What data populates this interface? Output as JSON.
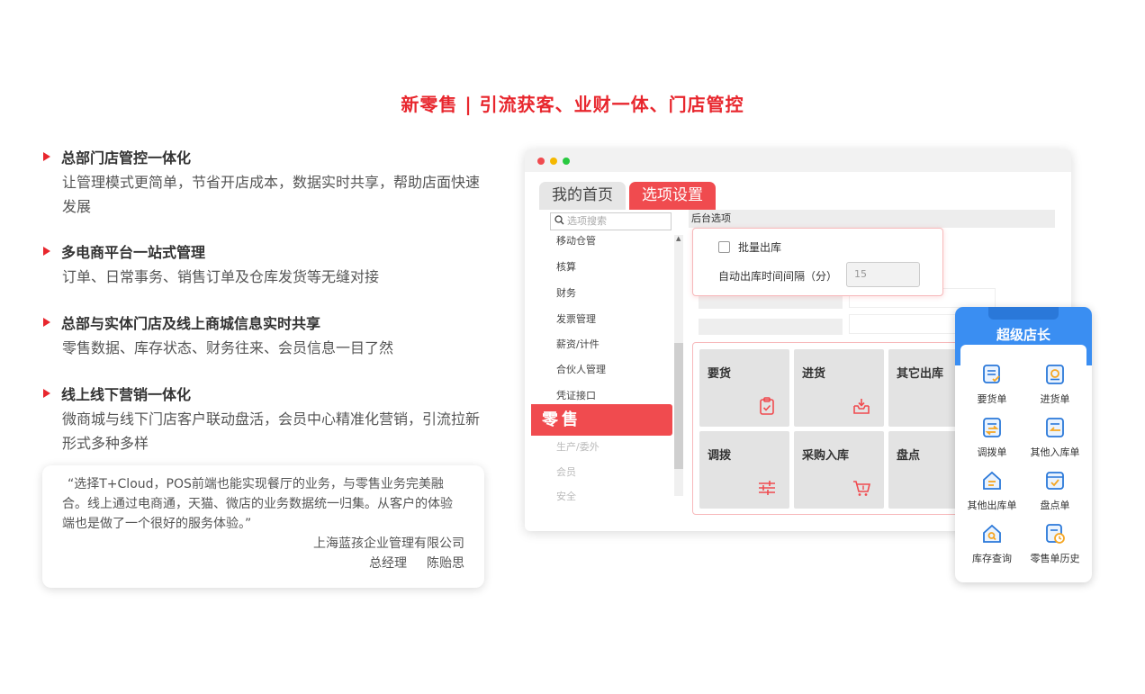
{
  "headline": "新零售 | 引流获客、业财一体、门店管控",
  "features": [
    {
      "title": "总部门店管控一体化",
      "desc": "让管理模式更简单，节省开店成本，数据实时共享，帮助店面快速发展"
    },
    {
      "title": "多电商平台一站式管理",
      "desc": "订单、日常事务、销售订单及仓库发货等无缝对接"
    },
    {
      "title": "总部与实体门店及线上商城信息实时共享",
      "desc": "零售数据、库存状态、财务往来、会员信息一目了然"
    },
    {
      "title": "线上线下营销一体化",
      "desc": "微商城与线下门店客户联动盘活，会员中心精准化营销，引流拉新形式多种多样"
    }
  ],
  "quote": {
    "text": "“选择T+Cloud，POS前端也能实现餐厅的业务，与零售业务完美融合。线上通过电商通，天猫、微店的业务数据统一归集。从客户的体验端也是做了一个很好的服务体验。”",
    "company": "上海蓝孩企业管理有限公司",
    "role": "总经理",
    "name": "陈贻思"
  },
  "window": {
    "tabs": [
      "我的首页",
      "选项设置"
    ],
    "search_placeholder": "选项搜索",
    "menu": [
      "移动仓管",
      "核算",
      "财务",
      "发票管理",
      "薪资/计件",
      "合伙人管理",
      "凭证接口"
    ],
    "menu_faded": [
      "生产/委外",
      "会员",
      "安全"
    ],
    "retail_tag": "零售",
    "panel_title": "后台选项",
    "option_batch": "批量出库",
    "option_interval_label": "自动出库时间间隔（分）",
    "option_interval_value": "15",
    "tiles": [
      "要货",
      "进货",
      "其它出库",
      "调拨",
      "采购入库",
      "盘点"
    ]
  },
  "phone": {
    "title": "超级店长",
    "items": [
      "要货单",
      "进货单",
      "调拨单",
      "其他入库单",
      "其他出库单",
      "盘点单",
      "库存查询",
      "零售单历史"
    ]
  },
  "colors": {
    "accent": "#e8262d",
    "tab_active": "#f04b4f",
    "phone_blue": "#3a8ef2"
  }
}
